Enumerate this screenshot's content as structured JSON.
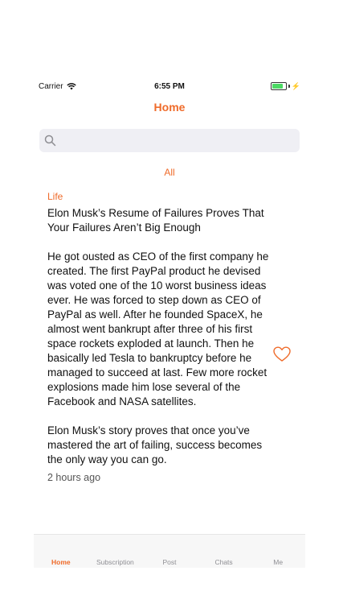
{
  "status_bar": {
    "carrier": "Carrier",
    "time": "6:55 PM",
    "battery_level": 0.85
  },
  "nav": {
    "title": "Home"
  },
  "search": {
    "placeholder": ""
  },
  "filter": {
    "label": "All"
  },
  "post": {
    "category": "Life",
    "title": "Elon Musk’s Resume of Failures Proves That Your Failures Aren’t Big Enough",
    "body": "He got ousted as CEO of the first company he created. The first PayPal product he devised was voted one of the 10 worst business ideas ever. He was forced to step down as CEO of PayPal as well. After he founded SpaceX, he almost went bankrupt after three of his first space rockets exploded at launch. Then he basically led Tesla to bankruptcy before he managed to succeed at last. Few more rocket explosions made him lose several of the Facebook and NASA satellites.\n\nElon Musk’s story proves that once you’ve mastered the art of failing, success becomes the only way you can go.",
    "time": "2 hours ago",
    "liked": false
  },
  "tabs": [
    {
      "label": "Home",
      "active": true
    },
    {
      "label": "Subscription",
      "active": false
    },
    {
      "label": "Post",
      "active": false
    },
    {
      "label": "Chats",
      "active": false
    },
    {
      "label": "Me",
      "active": false
    }
  ],
  "colors": {
    "accent": "#ef6b2a",
    "battery": "#4cd964",
    "search_bg": "#efeff4"
  }
}
